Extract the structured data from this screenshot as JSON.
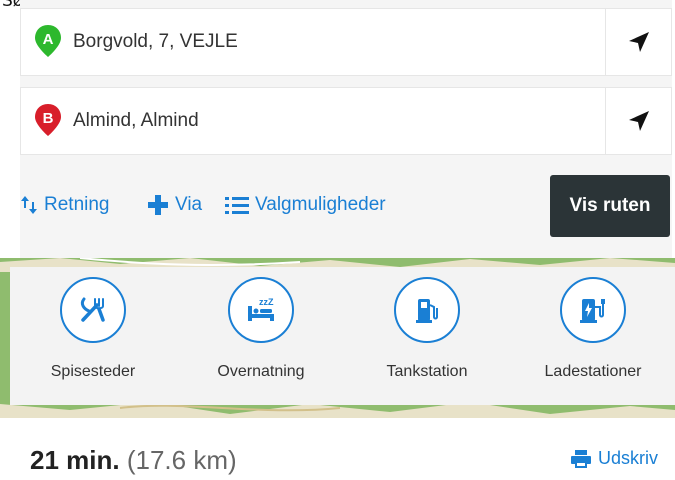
{
  "header": {
    "clipped_text": "Søgning):"
  },
  "route": {
    "from": {
      "marker": "A",
      "marker_color": "#2db82d",
      "value": "Borgvold, 7, VEJLE",
      "locate_icon": "locate-arrow-icon"
    },
    "to": {
      "marker": "B",
      "marker_color": "#d81e2a",
      "value": "Almind, Almind",
      "locate_icon": "locate-arrow-icon"
    }
  },
  "actions": {
    "direction": "Retning",
    "via": "Via",
    "options": "Valgmuligheder",
    "show_route": "Vis ruten"
  },
  "poi": [
    {
      "label": "Spisesteder",
      "icon": "restaurant-icon"
    },
    {
      "label": "Overnatning",
      "icon": "hotel-bed-icon"
    },
    {
      "label": "Tankstation",
      "icon": "fuel-pump-icon"
    },
    {
      "label": "Ladestationer",
      "icon": "ev-charger-icon"
    }
  ],
  "summary": {
    "duration": "21 min.",
    "distance": "(17.6 km)"
  },
  "print": {
    "label": "Udskriv",
    "icon": "printer-icon"
  },
  "colors": {
    "accent": "#1a7fd4",
    "dark_button": "#2b3437",
    "map_green": "#8fbc6e"
  }
}
